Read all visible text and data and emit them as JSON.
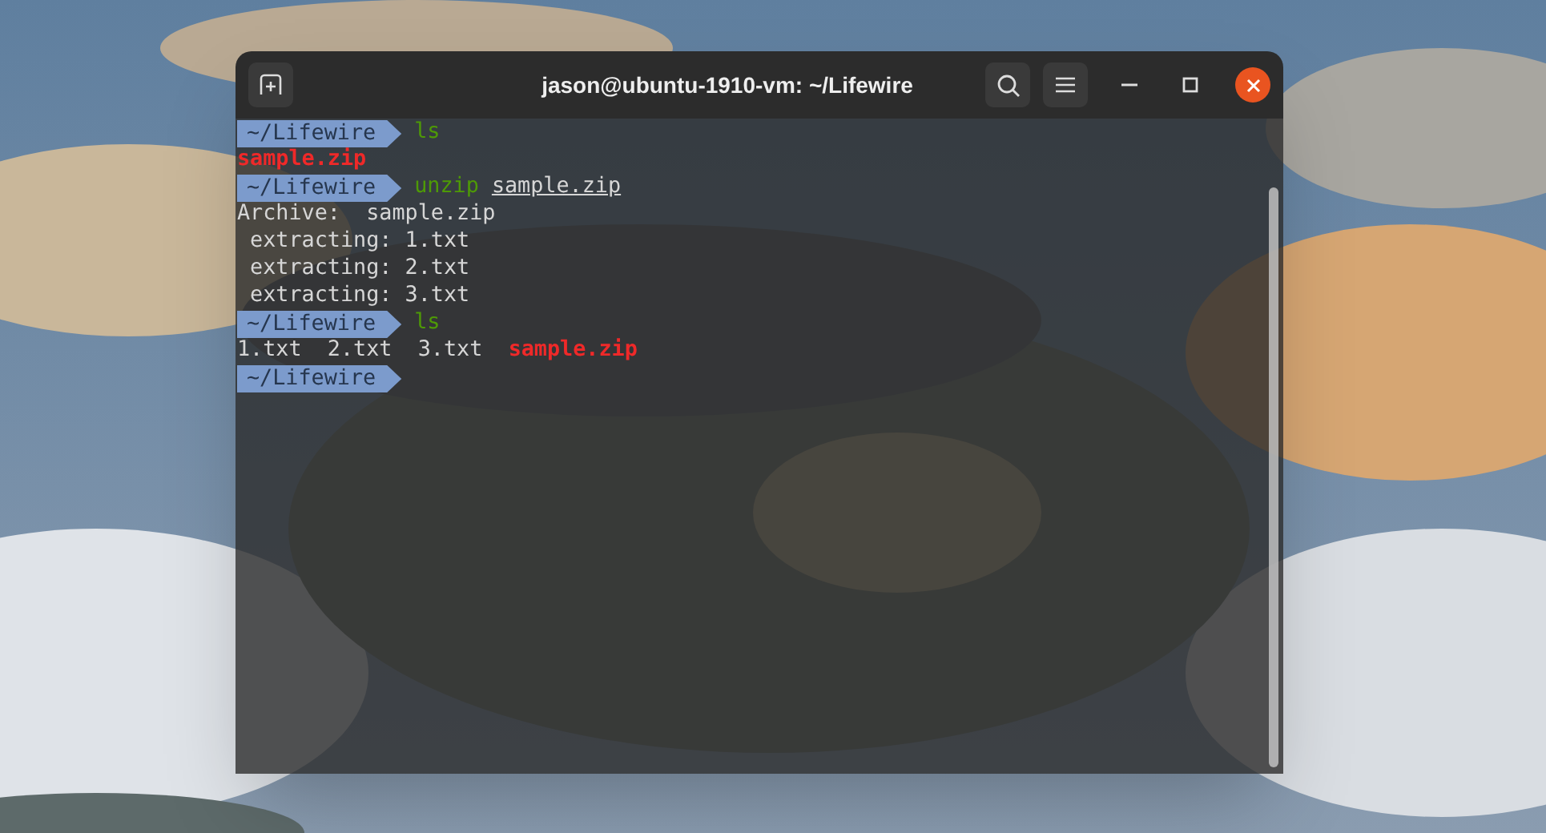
{
  "window": {
    "title": "jason@ubuntu-1910-vm: ~/Lifewire"
  },
  "terminal": {
    "lines": [
      {
        "segments": [
          {
            "kind": "prompt",
            "text": "~/Lifewire"
          },
          {
            "kind": "command",
            "text": "ls"
          }
        ]
      },
      {
        "segments": [
          {
            "kind": "archive",
            "text": "sample.zip"
          }
        ]
      },
      {
        "segments": [
          {
            "kind": "prompt",
            "text": "~/Lifewire"
          },
          {
            "kind": "command",
            "text": "unzip"
          },
          {
            "kind": "argument",
            "text": "sample.zip"
          }
        ]
      },
      {
        "segments": [
          {
            "kind": "output",
            "text": "Archive:  sample.zip"
          }
        ]
      },
      {
        "segments": [
          {
            "kind": "output",
            "text": " extracting: 1.txt"
          }
        ]
      },
      {
        "segments": [
          {
            "kind": "output",
            "text": " extracting: 2.txt"
          }
        ]
      },
      {
        "segments": [
          {
            "kind": "output",
            "text": " extracting: 3.txt"
          }
        ]
      },
      {
        "segments": [
          {
            "kind": "prompt",
            "text": "~/Lifewire"
          },
          {
            "kind": "command",
            "text": "ls"
          }
        ]
      },
      {
        "segments": [
          {
            "kind": "output",
            "text": "1.txt  2.txt  3.txt  "
          },
          {
            "kind": "archive",
            "text": "sample.zip"
          }
        ]
      },
      {
        "segments": [
          {
            "kind": "prompt",
            "text": "~/Lifewire"
          }
        ]
      }
    ]
  }
}
